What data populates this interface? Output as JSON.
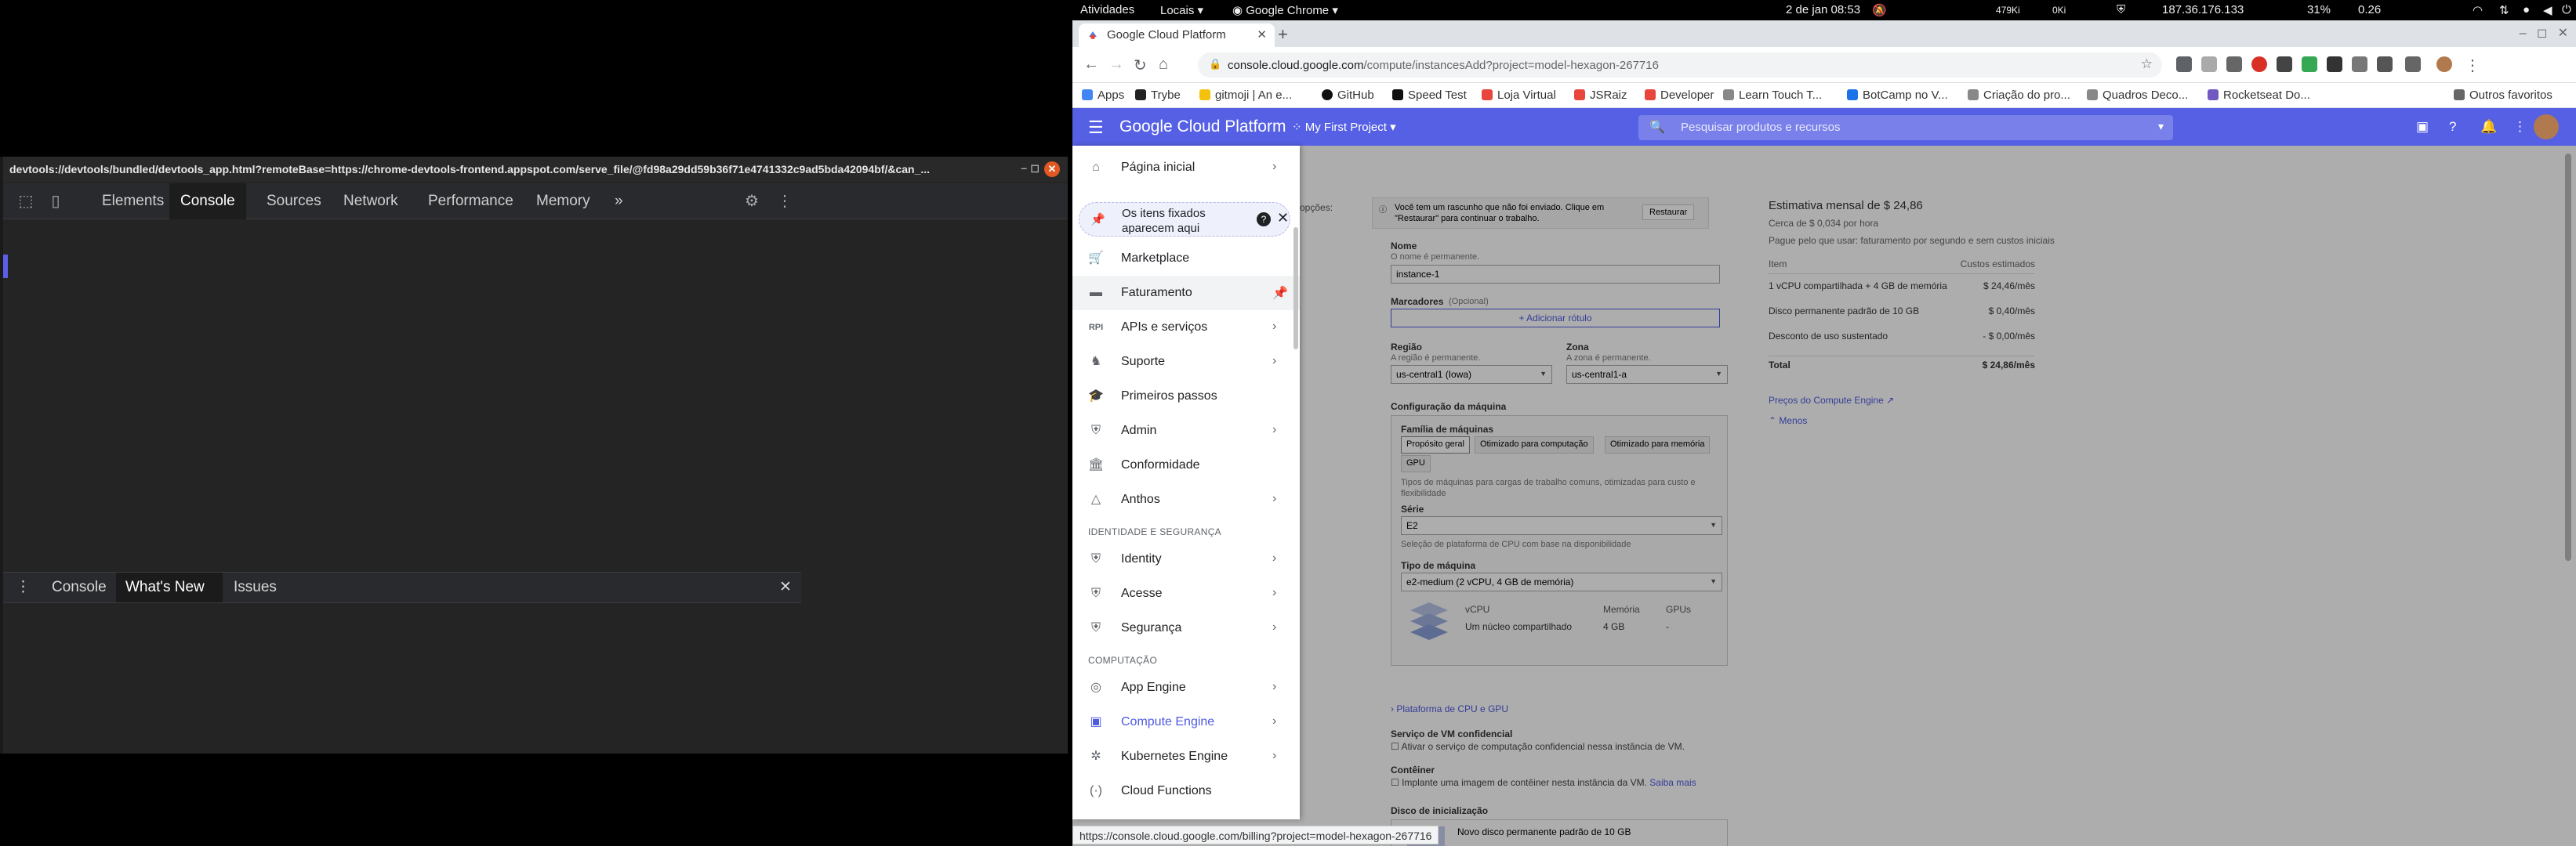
{
  "topbar": {
    "activities": "Atividades",
    "places": "Locais",
    "app": "Google Chrome",
    "clock": "2 de jan  08:53",
    "net_down": "479Ki",
    "net_up": "0Ki",
    "ip": "187.36.176.133",
    "battery": "31%",
    "load": "0.26"
  },
  "devtools": {
    "url": "devtools://devtools/bundled/devtools_app.html?remoteBase=https://chrome-devtools-frontend.appspot.com/serve_file/@fd98a29dd59b36f71e4741332c9ad5bda42094bf/&can_...",
    "tabs": [
      "Elements",
      "Console",
      "Sources",
      "Network",
      "Performance",
      "Memory"
    ],
    "more": "»",
    "drawer_tabs": [
      "Console",
      "What's New",
      "Issues"
    ]
  },
  "chrome": {
    "tab_title": "Google Cloud Platform",
    "url_host": "console.cloud.google.com",
    "url_path": "/compute/instancesAdd?project=model-hexagon-267716",
    "bookmarks": [
      "Apps",
      "Trybe",
      "gitmoji | An e...",
      "GitHub",
      "Speed Test",
      "Loja Virtual",
      "JSRaiz",
      "Developer",
      "Learn Touch T...",
      "BotCamp no V...",
      "Criação do pro...",
      "Quadros Deco...",
      "Rocketseat Do..."
    ],
    "other_bookmarks": "Outros favoritos",
    "status_url": "https://console.cloud.google.com/billing?project=model-hexagon-267716"
  },
  "gcp": {
    "title": "Google Cloud Platform",
    "project": "My First Project",
    "search_placeholder": "Pesquisar produtos e recursos"
  },
  "nav": {
    "home": "Página inicial",
    "pinned_hint_l1": "Os itens fixados",
    "pinned_hint_l2": "aparecem aqui",
    "items_top": [
      "Marketplace",
      "Faturamento",
      "APIs e serviços",
      "Suporte",
      "Primeiros passos",
      "Admin",
      "Conformidade",
      "Anthos"
    ],
    "section_identity": "IDENTIDADE E SEGURANÇA",
    "items_identity": [
      "Identity",
      "Acesse",
      "Segurança"
    ],
    "section_compute": "COMPUTAÇÃO",
    "items_compute": [
      "App Engine",
      "Compute Engine",
      "Kubernetes Engine",
      "Cloud Functions"
    ]
  },
  "form": {
    "partial_options": "opções:",
    "draft_notice": "Você tem um rascunho que não foi enviado. Clique em \"Restaurar\" para continuar o trabalho.",
    "restore": "Restaurar",
    "name_label": "Nome",
    "name_hint": "O nome é permanente.",
    "name_value": "instance-1",
    "labels_label": "Marcadores",
    "labels_optional": "(Opcional)",
    "add_label": "Adicionar rótulo",
    "region_label": "Região",
    "region_hint": "A região é permanente.",
    "region_value": "us-central1 (Iowa)",
    "zone_label": "Zona",
    "zone_hint": "A zona é permanente.",
    "zone_value": "us-central1-a",
    "machine_config": "Configuração da máquina",
    "machine_family": "Família de máquinas",
    "family_tabs": [
      "Propósito geral",
      "Otimizado para computação",
      "Otimizado para memória",
      "GPU"
    ],
    "family_desc": "Tipos de máquinas para cargas de trabalho comuns, otimizadas para custo e flexibilidade",
    "series_label": "Série",
    "series_value": "E2",
    "series_hint": "Seleção de plataforma de CPU com base na disponibilidade",
    "machine_type_label": "Tipo de máquina",
    "machine_type_value": "e2-medium (2 vCPU, 4 GB de memória)",
    "spec_headers": [
      "vCPU",
      "Memória",
      "GPUs"
    ],
    "spec_values": [
      "Um núcleo compartilhado",
      "4 GB",
      "-"
    ],
    "cpu_platform_link": "Plataforma de CPU e GPU",
    "confidential_label": "Serviço de VM confidencial",
    "confidential_check": "Ativar o serviço de computação confidencial nessa instância de VM.",
    "container_label": "Contêiner",
    "container_check": "Implante uma imagem de contêiner nesta instância da VM.",
    "learn_more": "Saiba mais",
    "boot_disk_label": "Disco de inicialização",
    "boot_disk_value": "Novo disco permanente padrão de 10 GB"
  },
  "estimate": {
    "title": "Estimativa mensal de $ 24,86",
    "hourly": "Cerca de $ 0,034 por hora",
    "billing_note": "Pague pelo que usar: faturamento por segundo e sem custos iniciais",
    "col_item": "Item",
    "col_cost": "Custos estimados",
    "rows": [
      {
        "item": "1 vCPU compartilhada + 4 GB de memória",
        "cost": "$ 24,46/mês"
      },
      {
        "item": "Disco permanente padrão de 10 GB",
        "cost": "$ 0,40/mês"
      },
      {
        "item": "Desconto de uso sustentado",
        "cost": "- $ 0,00/mês"
      },
      {
        "item": "Total",
        "cost": "$ 24,86/mês"
      }
    ],
    "pricing_link": "Preços do Compute Engine",
    "less": "Menos"
  }
}
